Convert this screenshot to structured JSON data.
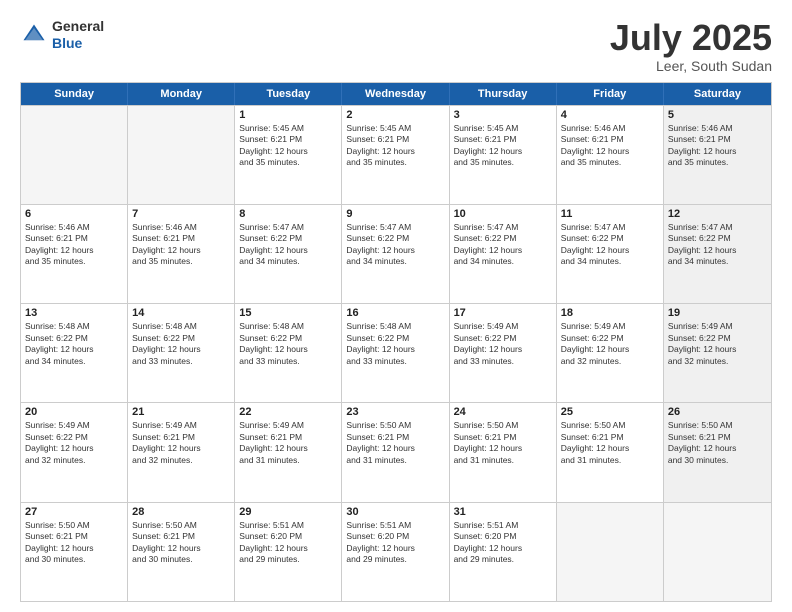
{
  "header": {
    "logo_line1": "General",
    "logo_line2": "Blue",
    "month": "July 2025",
    "location": "Leer, South Sudan"
  },
  "weekdays": [
    "Sunday",
    "Monday",
    "Tuesday",
    "Wednesday",
    "Thursday",
    "Friday",
    "Saturday"
  ],
  "rows": [
    [
      {
        "day": "",
        "text": "",
        "empty": true
      },
      {
        "day": "",
        "text": "",
        "empty": true
      },
      {
        "day": "1",
        "text": "Sunrise: 5:45 AM\nSunset: 6:21 PM\nDaylight: 12 hours\nand 35 minutes."
      },
      {
        "day": "2",
        "text": "Sunrise: 5:45 AM\nSunset: 6:21 PM\nDaylight: 12 hours\nand 35 minutes."
      },
      {
        "day": "3",
        "text": "Sunrise: 5:45 AM\nSunset: 6:21 PM\nDaylight: 12 hours\nand 35 minutes."
      },
      {
        "day": "4",
        "text": "Sunrise: 5:46 AM\nSunset: 6:21 PM\nDaylight: 12 hours\nand 35 minutes."
      },
      {
        "day": "5",
        "text": "Sunrise: 5:46 AM\nSunset: 6:21 PM\nDaylight: 12 hours\nand 35 minutes.",
        "shaded": true
      }
    ],
    [
      {
        "day": "6",
        "text": "Sunrise: 5:46 AM\nSunset: 6:21 PM\nDaylight: 12 hours\nand 35 minutes."
      },
      {
        "day": "7",
        "text": "Sunrise: 5:46 AM\nSunset: 6:21 PM\nDaylight: 12 hours\nand 35 minutes."
      },
      {
        "day": "8",
        "text": "Sunrise: 5:47 AM\nSunset: 6:22 PM\nDaylight: 12 hours\nand 34 minutes."
      },
      {
        "day": "9",
        "text": "Sunrise: 5:47 AM\nSunset: 6:22 PM\nDaylight: 12 hours\nand 34 minutes."
      },
      {
        "day": "10",
        "text": "Sunrise: 5:47 AM\nSunset: 6:22 PM\nDaylight: 12 hours\nand 34 minutes."
      },
      {
        "day": "11",
        "text": "Sunrise: 5:47 AM\nSunset: 6:22 PM\nDaylight: 12 hours\nand 34 minutes."
      },
      {
        "day": "12",
        "text": "Sunrise: 5:47 AM\nSunset: 6:22 PM\nDaylight: 12 hours\nand 34 minutes.",
        "shaded": true
      }
    ],
    [
      {
        "day": "13",
        "text": "Sunrise: 5:48 AM\nSunset: 6:22 PM\nDaylight: 12 hours\nand 34 minutes."
      },
      {
        "day": "14",
        "text": "Sunrise: 5:48 AM\nSunset: 6:22 PM\nDaylight: 12 hours\nand 33 minutes."
      },
      {
        "day": "15",
        "text": "Sunrise: 5:48 AM\nSunset: 6:22 PM\nDaylight: 12 hours\nand 33 minutes."
      },
      {
        "day": "16",
        "text": "Sunrise: 5:48 AM\nSunset: 6:22 PM\nDaylight: 12 hours\nand 33 minutes."
      },
      {
        "day": "17",
        "text": "Sunrise: 5:49 AM\nSunset: 6:22 PM\nDaylight: 12 hours\nand 33 minutes."
      },
      {
        "day": "18",
        "text": "Sunrise: 5:49 AM\nSunset: 6:22 PM\nDaylight: 12 hours\nand 32 minutes."
      },
      {
        "day": "19",
        "text": "Sunrise: 5:49 AM\nSunset: 6:22 PM\nDaylight: 12 hours\nand 32 minutes.",
        "shaded": true
      }
    ],
    [
      {
        "day": "20",
        "text": "Sunrise: 5:49 AM\nSunset: 6:22 PM\nDaylight: 12 hours\nand 32 minutes."
      },
      {
        "day": "21",
        "text": "Sunrise: 5:49 AM\nSunset: 6:21 PM\nDaylight: 12 hours\nand 32 minutes."
      },
      {
        "day": "22",
        "text": "Sunrise: 5:49 AM\nSunset: 6:21 PM\nDaylight: 12 hours\nand 31 minutes."
      },
      {
        "day": "23",
        "text": "Sunrise: 5:50 AM\nSunset: 6:21 PM\nDaylight: 12 hours\nand 31 minutes."
      },
      {
        "day": "24",
        "text": "Sunrise: 5:50 AM\nSunset: 6:21 PM\nDaylight: 12 hours\nand 31 minutes."
      },
      {
        "day": "25",
        "text": "Sunrise: 5:50 AM\nSunset: 6:21 PM\nDaylight: 12 hours\nand 31 minutes."
      },
      {
        "day": "26",
        "text": "Sunrise: 5:50 AM\nSunset: 6:21 PM\nDaylight: 12 hours\nand 30 minutes.",
        "shaded": true
      }
    ],
    [
      {
        "day": "27",
        "text": "Sunrise: 5:50 AM\nSunset: 6:21 PM\nDaylight: 12 hours\nand 30 minutes."
      },
      {
        "day": "28",
        "text": "Sunrise: 5:50 AM\nSunset: 6:21 PM\nDaylight: 12 hours\nand 30 minutes."
      },
      {
        "day": "29",
        "text": "Sunrise: 5:51 AM\nSunset: 6:20 PM\nDaylight: 12 hours\nand 29 minutes."
      },
      {
        "day": "30",
        "text": "Sunrise: 5:51 AM\nSunset: 6:20 PM\nDaylight: 12 hours\nand 29 minutes."
      },
      {
        "day": "31",
        "text": "Sunrise: 5:51 AM\nSunset: 6:20 PM\nDaylight: 12 hours\nand 29 minutes."
      },
      {
        "day": "",
        "text": "",
        "empty": true
      },
      {
        "day": "",
        "text": "",
        "empty": true,
        "shaded": true
      }
    ]
  ]
}
